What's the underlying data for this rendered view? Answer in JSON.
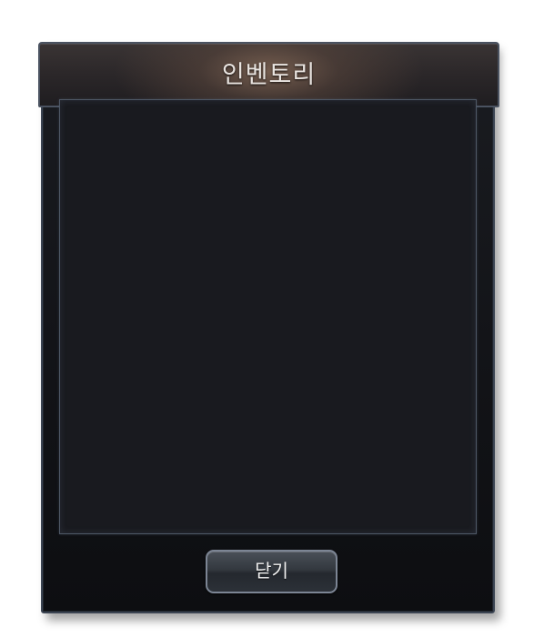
{
  "window": {
    "title": "인벤토리",
    "close_label": "닫기"
  },
  "colors": {
    "frame_border": "#3b4452",
    "panel_bg": "#191a1f",
    "title_text": "#e9e4e0",
    "title_glow": "#8c6e5a"
  }
}
